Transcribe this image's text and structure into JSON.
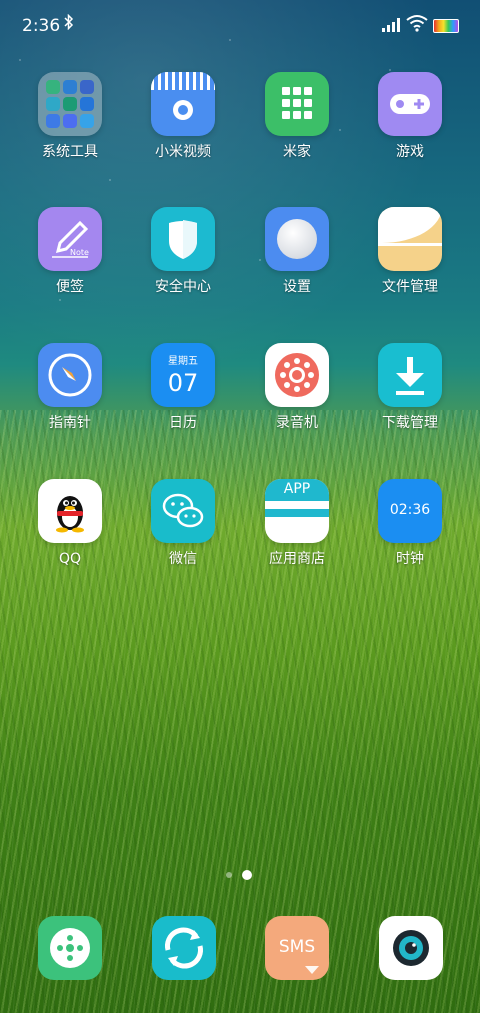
{
  "status_bar": {
    "time": "2:36"
  },
  "apps": [
    {
      "label": "系统工具"
    },
    {
      "label": "小米视频"
    },
    {
      "label": "米家"
    },
    {
      "label": "游戏"
    },
    {
      "label": "便签",
      "icon_text": "Note"
    },
    {
      "label": "安全中心"
    },
    {
      "label": "设置"
    },
    {
      "label": "文件管理"
    },
    {
      "label": "指南针"
    },
    {
      "label": "日历",
      "icon_weekday": "星期五",
      "icon_day": "07"
    },
    {
      "label": "录音机"
    },
    {
      "label": "下载管理"
    },
    {
      "label": "QQ"
    },
    {
      "label": "微信"
    },
    {
      "label": "应用商店",
      "icon_text": "APP"
    },
    {
      "label": "时钟",
      "icon_text": "02:36"
    }
  ],
  "dock": [
    {
      "name": "phone"
    },
    {
      "name": "browser"
    },
    {
      "name": "messages",
      "icon_text": "SMS"
    },
    {
      "name": "camera"
    }
  ],
  "page_indicator": {
    "pages": 2,
    "current": 2
  }
}
